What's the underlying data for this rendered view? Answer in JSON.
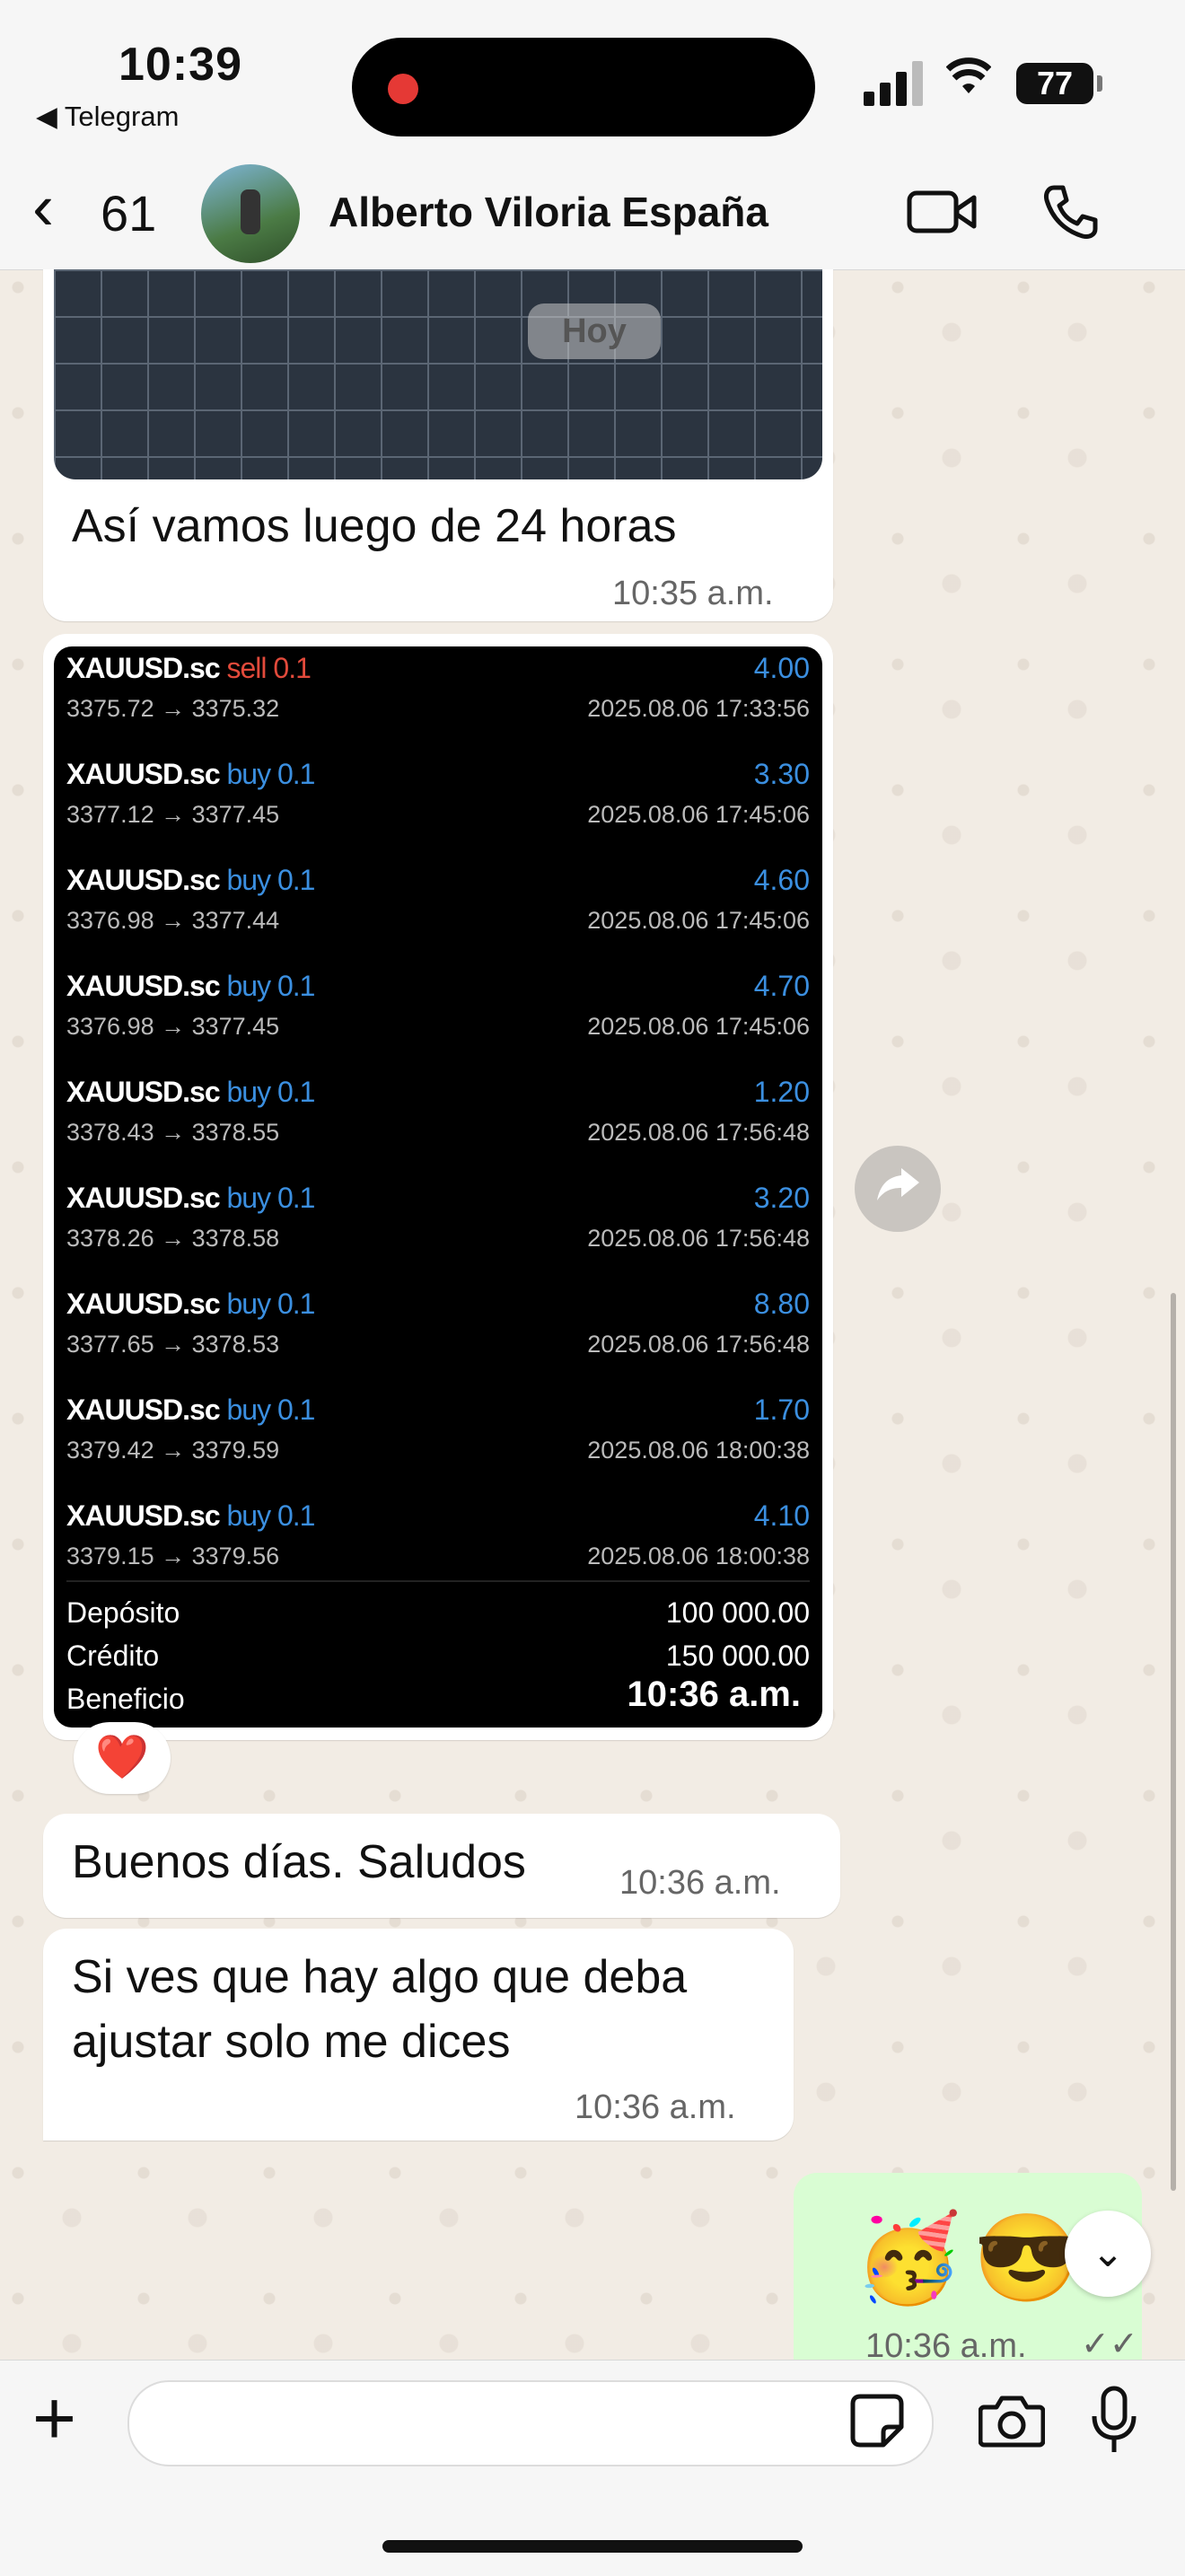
{
  "status_bar": {
    "time": "10:39",
    "back_app": "◀ Telegram",
    "battery": "77"
  },
  "header": {
    "unread_count": "61",
    "contact_name": "Alberto Viloria España"
  },
  "messages": {
    "image_date_chip": "Hoy",
    "msg1_text": "Así vamos luego de 24 horas",
    "msg1_time": "10:35 a.m.",
    "trades": [
      {
        "symbol": "XAUUSD.sc",
        "side": "sell 0.1",
        "side_color": "#e24a3b",
        "pl": "4.00",
        "prices": "3375.72 → 3375.32",
        "date": "2025.08.06 17:33:56"
      },
      {
        "symbol": "XAUUSD.sc",
        "side": "buy 0.1",
        "side_color": "#3b8fe0",
        "pl": "3.30",
        "prices": "3377.12 → 3377.45",
        "date": "2025.08.06 17:45:06"
      },
      {
        "symbol": "XAUUSD.sc",
        "side": "buy 0.1",
        "side_color": "#3b8fe0",
        "pl": "4.60",
        "prices": "3376.98 → 3377.44",
        "date": "2025.08.06 17:45:06"
      },
      {
        "symbol": "XAUUSD.sc",
        "side": "buy 0.1",
        "side_color": "#3b8fe0",
        "pl": "4.70",
        "prices": "3376.98 → 3377.45",
        "date": "2025.08.06 17:45:06"
      },
      {
        "symbol": "XAUUSD.sc",
        "side": "buy 0.1",
        "side_color": "#3b8fe0",
        "pl": "1.20",
        "prices": "3378.43 → 3378.55",
        "date": "2025.08.06 17:56:48"
      },
      {
        "symbol": "XAUUSD.sc",
        "side": "buy 0.1",
        "side_color": "#3b8fe0",
        "pl": "3.20",
        "prices": "3378.26 → 3378.58",
        "date": "2025.08.06 17:56:48"
      },
      {
        "symbol": "XAUUSD.sc",
        "side": "buy 0.1",
        "side_color": "#3b8fe0",
        "pl": "8.80",
        "prices": "3377.65 → 3378.53",
        "date": "2025.08.06 17:56:48"
      },
      {
        "symbol": "XAUUSD.sc",
        "side": "buy 0.1",
        "side_color": "#3b8fe0",
        "pl": "1.70",
        "prices": "3379.42 → 3379.59",
        "date": "2025.08.06 18:00:38"
      },
      {
        "symbol": "XAUUSD.sc",
        "side": "buy 0.1",
        "side_color": "#3b8fe0",
        "pl": "4.10",
        "prices": "3379.15 → 3379.56",
        "date": "2025.08.06 18:00:38"
      }
    ],
    "summary": [
      {
        "label": "Depósito",
        "value": "100 000.00"
      },
      {
        "label": "Crédito",
        "value": "150 000.00"
      },
      {
        "label": "Beneficio",
        "value": ""
      }
    ],
    "trade_image_time": "10:36 a.m.",
    "reaction": "❤️",
    "msg2_text": "Buenos días. Saludos",
    "msg2_time": "10:36 a.m.",
    "msg3_text": "Si ves que hay algo que deba ajustar solo me dices",
    "msg3_time": "10:36 a.m.",
    "out_emoji_1": "🥳",
    "out_emoji_2": "😎",
    "out_time": "10:36 a.m.",
    "out_status": "✓✓"
  },
  "icons": {
    "forward": "forward-icon",
    "scroll_down": "chevron-down-icon"
  }
}
